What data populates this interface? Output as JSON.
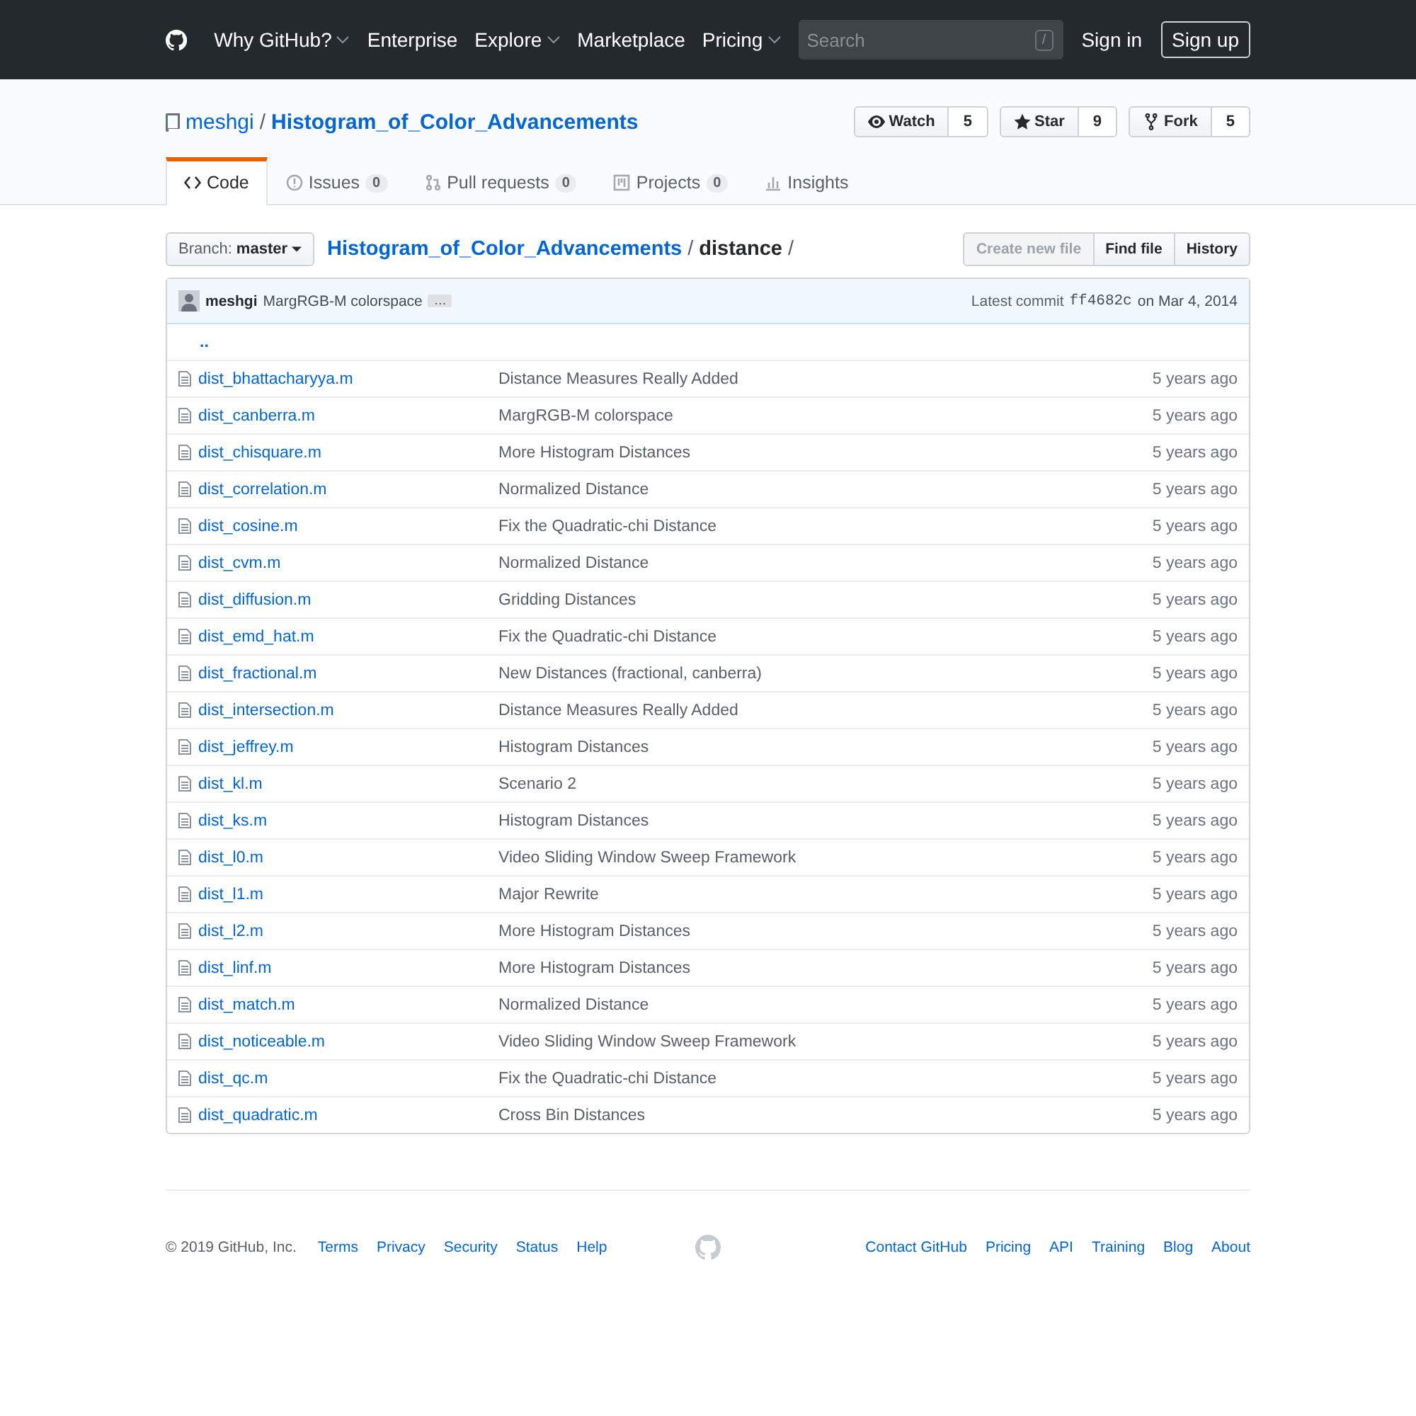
{
  "header": {
    "nav": [
      {
        "label": "Why GitHub?",
        "dropdown": true
      },
      {
        "label": "Enterprise",
        "dropdown": false
      },
      {
        "label": "Explore",
        "dropdown": true
      },
      {
        "label": "Marketplace",
        "dropdown": false
      },
      {
        "label": "Pricing",
        "dropdown": true
      }
    ],
    "search": {
      "placeholder": "Search",
      "shortcut": "/"
    },
    "sign_in": "Sign in",
    "sign_up": "Sign up"
  },
  "repo": {
    "owner": "meshgi",
    "separator": "/",
    "name": "Histogram_of_Color_Advancements",
    "actions": [
      {
        "kind": "watch",
        "label": "Watch",
        "count": "5"
      },
      {
        "kind": "star",
        "label": "Star",
        "count": "9"
      },
      {
        "kind": "fork",
        "label": "Fork",
        "count": "5"
      }
    ],
    "tabs": [
      {
        "kind": "code",
        "label": "Code",
        "selected": true
      },
      {
        "kind": "issues",
        "label": "Issues",
        "counter": "0",
        "selected": false
      },
      {
        "kind": "pulls",
        "label": "Pull requests",
        "counter": "0",
        "selected": false
      },
      {
        "kind": "projects",
        "label": "Projects",
        "counter": "0",
        "selected": false
      },
      {
        "kind": "insights",
        "label": "Insights",
        "selected": false
      }
    ]
  },
  "file_nav": {
    "branch_label": "Branch:",
    "branch": "master",
    "path_root": "Histogram_of_Color_Advancements",
    "path_sep": "/",
    "path_dir": "distance",
    "path_end": "/",
    "buttons": [
      {
        "label": "Create new file",
        "disabled": true
      },
      {
        "label": "Find file",
        "disabled": false
      },
      {
        "label": "History",
        "disabled": false
      }
    ]
  },
  "commit": {
    "author": "meshgi",
    "message": "MargRGB-M colorspace",
    "ellipsis": "…",
    "latest_label": "Latest commit",
    "sha": "ff4682c",
    "date_text": "on Mar 4, 2014"
  },
  "parent_dir": "..",
  "files": [
    {
      "name": "dist_bhattacharyya.m",
      "message": "Distance Measures Really Added",
      "age": "5 years ago"
    },
    {
      "name": "dist_canberra.m",
      "message": "MargRGB-M colorspace",
      "age": "5 years ago"
    },
    {
      "name": "dist_chisquare.m",
      "message": "More Histogram Distances",
      "age": "5 years ago"
    },
    {
      "name": "dist_correlation.m",
      "message": "Normalized Distance",
      "age": "5 years ago"
    },
    {
      "name": "dist_cosine.m",
      "message": "Fix the Quadratic-chi Distance",
      "age": "5 years ago"
    },
    {
      "name": "dist_cvm.m",
      "message": "Normalized Distance",
      "age": "5 years ago"
    },
    {
      "name": "dist_diffusion.m",
      "message": "Gridding Distances",
      "age": "5 years ago"
    },
    {
      "name": "dist_emd_hat.m",
      "message": "Fix the Quadratic-chi Distance",
      "age": "5 years ago"
    },
    {
      "name": "dist_fractional.m",
      "message": "New Distances (fractional, canberra)",
      "age": "5 years ago"
    },
    {
      "name": "dist_intersection.m",
      "message": "Distance Measures Really Added",
      "age": "5 years ago"
    },
    {
      "name": "dist_jeffrey.m",
      "message": "Histogram Distances",
      "age": "5 years ago"
    },
    {
      "name": "dist_kl.m",
      "message": "Scenario 2",
      "age": "5 years ago"
    },
    {
      "name": "dist_ks.m",
      "message": "Histogram Distances",
      "age": "5 years ago"
    },
    {
      "name": "dist_l0.m",
      "message": "Video Sliding Window Sweep Framework",
      "age": "5 years ago"
    },
    {
      "name": "dist_l1.m",
      "message": "Major Rewrite",
      "age": "5 years ago"
    },
    {
      "name": "dist_l2.m",
      "message": "More Histogram Distances",
      "age": "5 years ago"
    },
    {
      "name": "dist_linf.m",
      "message": "More Histogram Distances",
      "age": "5 years ago"
    },
    {
      "name": "dist_match.m",
      "message": "Normalized Distance",
      "age": "5 years ago"
    },
    {
      "name": "dist_noticeable.m",
      "message": "Video Sliding Window Sweep Framework",
      "age": "5 years ago"
    },
    {
      "name": "dist_qc.m",
      "message": "Fix the Quadratic-chi Distance",
      "age": "5 years ago"
    },
    {
      "name": "dist_quadratic.m",
      "message": "Cross Bin Distances",
      "age": "5 years ago"
    }
  ],
  "footer": {
    "copyright": "© 2019 GitHub, Inc.",
    "left_links": [
      "Terms",
      "Privacy",
      "Security",
      "Status",
      "Help"
    ],
    "right_links": [
      "Contact GitHub",
      "Pricing",
      "API",
      "Training",
      "Blog",
      "About"
    ]
  }
}
